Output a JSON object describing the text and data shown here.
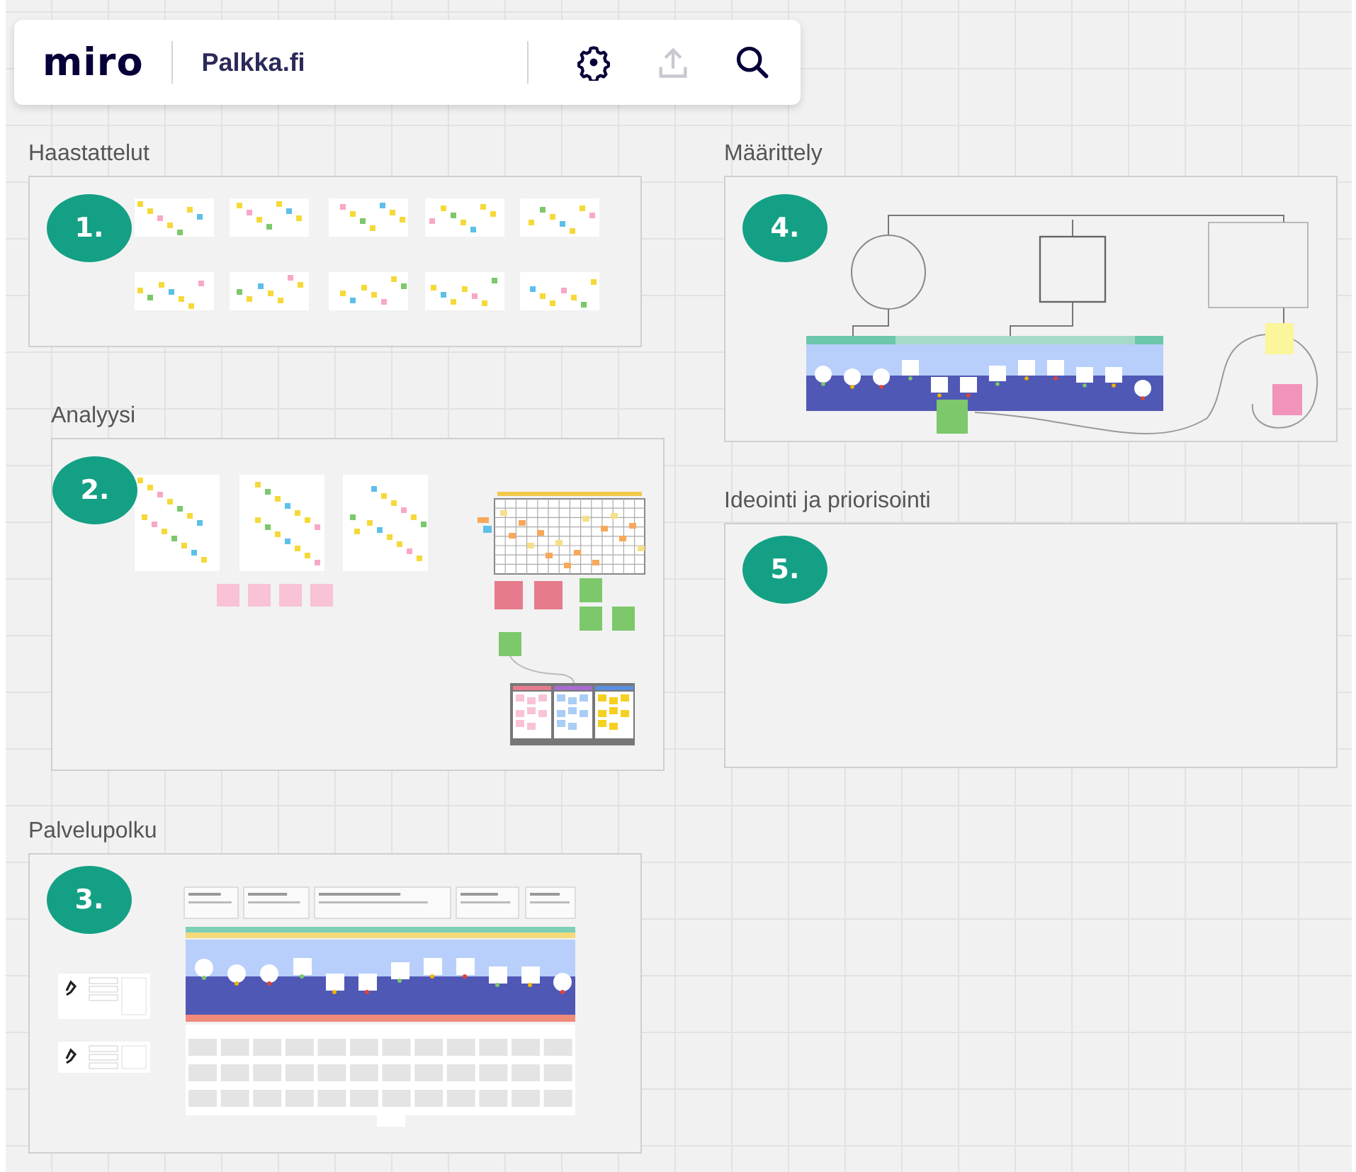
{
  "toolbar": {
    "logo": "miro",
    "board_name": "Palkka.fi",
    "tools": [
      {
        "kind": "settings",
        "disabled": false
      },
      {
        "kind": "share",
        "disabled": true
      },
      {
        "kind": "search",
        "disabled": false
      }
    ]
  },
  "frames": [
    {
      "title": "Haastattelut",
      "number": "1.",
      "kind": "interviews"
    },
    {
      "title": "Analyysi",
      "number": "2.",
      "kind": "analysis"
    },
    {
      "title": "Palvelupolku",
      "number": "3.",
      "kind": "journey"
    },
    {
      "title": "Määrittely",
      "number": "4.",
      "kind": "definition"
    },
    {
      "title": "Ideointi ja priorisointi",
      "number": "5.",
      "kind": "empty"
    }
  ]
}
